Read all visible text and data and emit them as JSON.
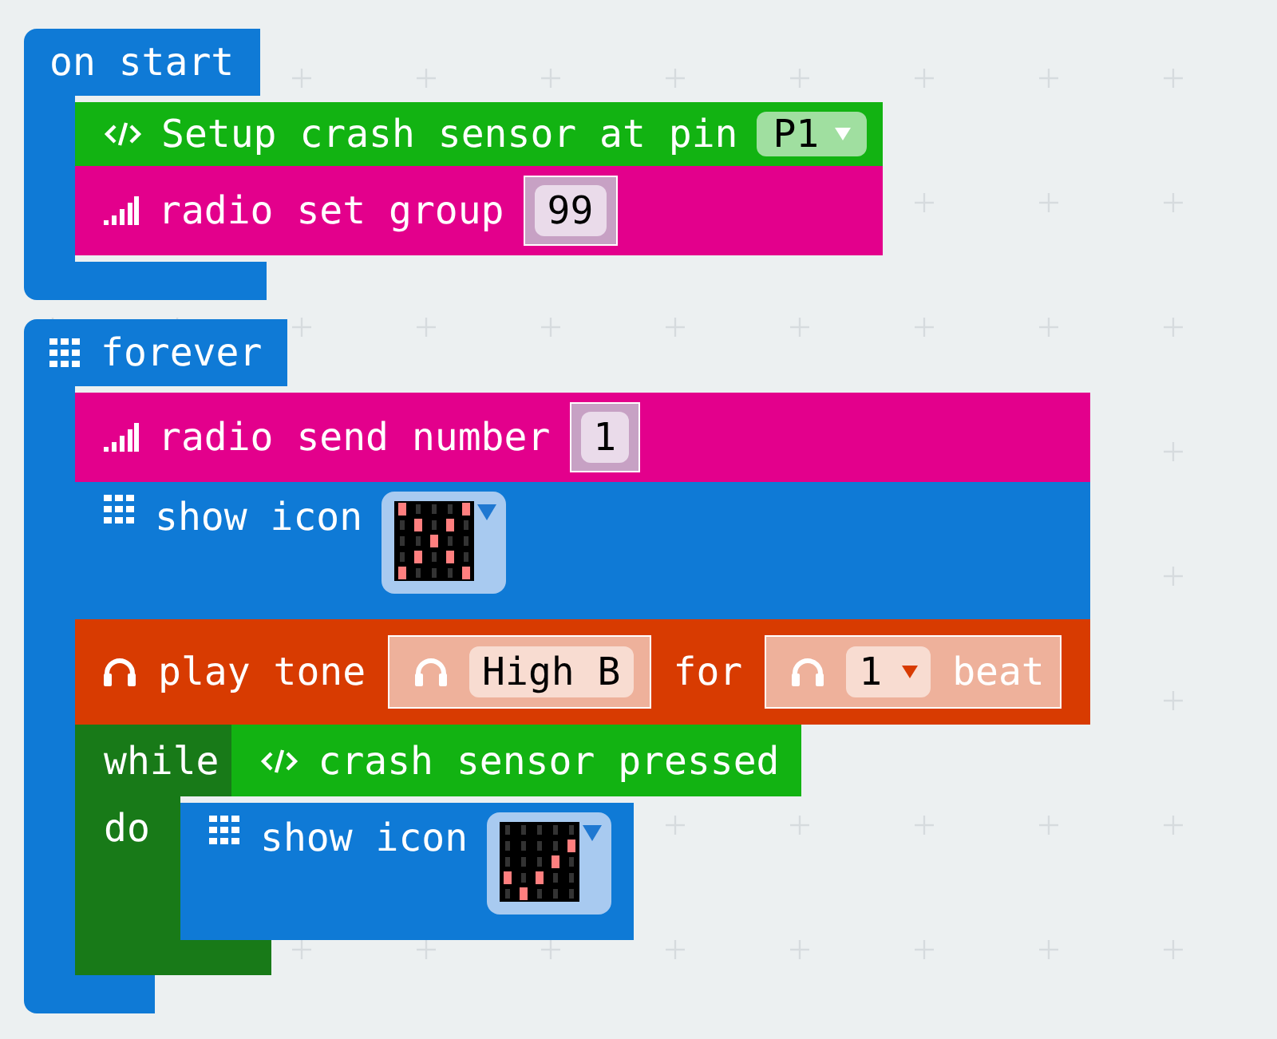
{
  "on_start": {
    "label": "on start",
    "blocks": [
      {
        "kind": "setup",
        "label": "Setup crash sensor at pin",
        "dropdown": "P1"
      },
      {
        "kind": "radio_group",
        "label": "radio set group",
        "value": "99"
      }
    ]
  },
  "forever": {
    "label": "forever",
    "blocks": [
      {
        "kind": "radio_send",
        "label": "radio send number",
        "value": "1"
      },
      {
        "kind": "show_icon",
        "label": "show icon",
        "leds": [
          [
            true,
            false,
            false,
            false,
            true
          ],
          [
            false,
            true,
            false,
            true,
            false
          ],
          [
            false,
            false,
            true,
            false,
            false
          ],
          [
            false,
            true,
            false,
            true,
            false
          ],
          [
            true,
            false,
            false,
            false,
            true
          ]
        ]
      },
      {
        "kind": "play_tone",
        "label": "play tone",
        "note": "High B",
        "for_label": "for",
        "beat": "1",
        "beat_label": "beat"
      },
      {
        "kind": "while",
        "label": "while",
        "condition": "crash sensor pressed",
        "do_label": "do",
        "blocks": [
          {
            "kind": "show_icon",
            "label": "show icon",
            "leds": [
              [
                false,
                false,
                false,
                false,
                false
              ],
              [
                false,
                false,
                false,
                false,
                true
              ],
              [
                false,
                false,
                false,
                true,
                false
              ],
              [
                true,
                false,
                true,
                false,
                false
              ],
              [
                false,
                true,
                false,
                false,
                false
              ]
            ]
          }
        ]
      }
    ]
  }
}
